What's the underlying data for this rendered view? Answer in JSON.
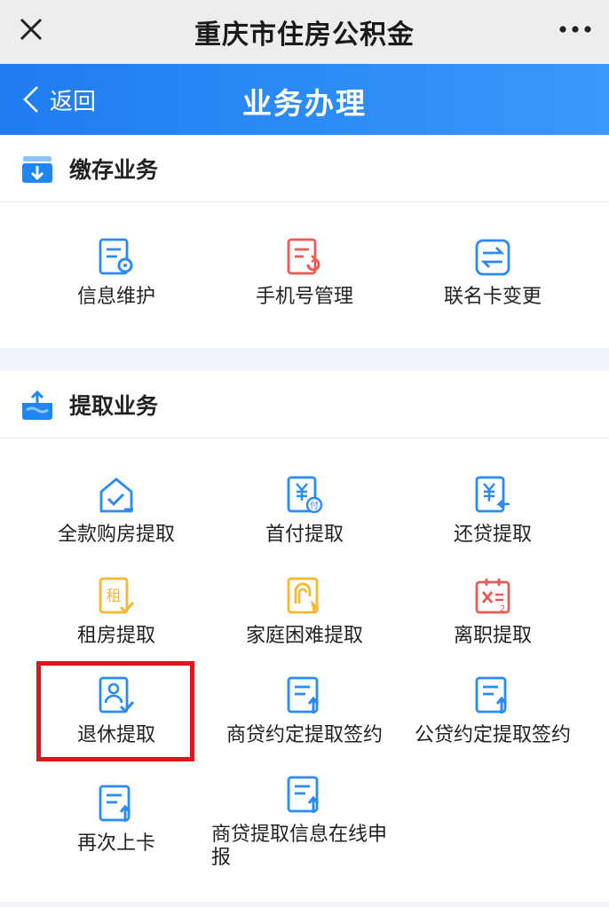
{
  "topbar": {
    "title": "重庆市住房公积金",
    "close_icon": "close-icon",
    "more_icon": "more-icon"
  },
  "header": {
    "back_label": "返回",
    "title": "业务办理",
    "accent": "#1f7cf2"
  },
  "deposit": {
    "title": "缴存业务",
    "items": [
      {
        "label": "信息维护",
        "icon": "document-gear-icon",
        "color": "#2a8af6"
      },
      {
        "label": "手机号管理",
        "icon": "document-refresh-icon",
        "color": "#e85a52"
      },
      {
        "label": "联名卡变更",
        "icon": "exchange-icon",
        "color": "#2a8af6"
      }
    ]
  },
  "withdraw": {
    "title": "提取业务",
    "items": [
      {
        "label": "全款购房提取",
        "icon": "house-check-icon",
        "color": "#2a8af6"
      },
      {
        "label": "首付提取",
        "icon": "yuan-pay-icon",
        "color": "#2a8af6"
      },
      {
        "label": "还贷提取",
        "icon": "yuan-return-icon",
        "color": "#2a8af6"
      },
      {
        "label": "租房提取",
        "icon": "rent-icon",
        "color": "#f5b82e"
      },
      {
        "label": "家庭困难提取",
        "icon": "hardship-icon",
        "color": "#f5b82e"
      },
      {
        "label": "离职提取",
        "icon": "resign-icon",
        "color": "#e85a52"
      },
      {
        "label": "退休提取",
        "icon": "retire-person-icon",
        "color": "#2a8af6"
      },
      {
        "label": "商贷约定提取签约",
        "icon": "doc-upload-icon",
        "color": "#2a8af6"
      },
      {
        "label": "公贷约定提取签约",
        "icon": "doc-upload-icon",
        "color": "#2a8af6"
      },
      {
        "label": "再次上卡",
        "icon": "doc-upload-icon",
        "color": "#2a8af6"
      },
      {
        "label": "商贷提取信息在线申报",
        "icon": "doc-upload-icon",
        "color": "#2a8af6"
      }
    ]
  },
  "annotation": {
    "highlight_color": "#e0141b",
    "highlighted_item": "退休提取"
  }
}
